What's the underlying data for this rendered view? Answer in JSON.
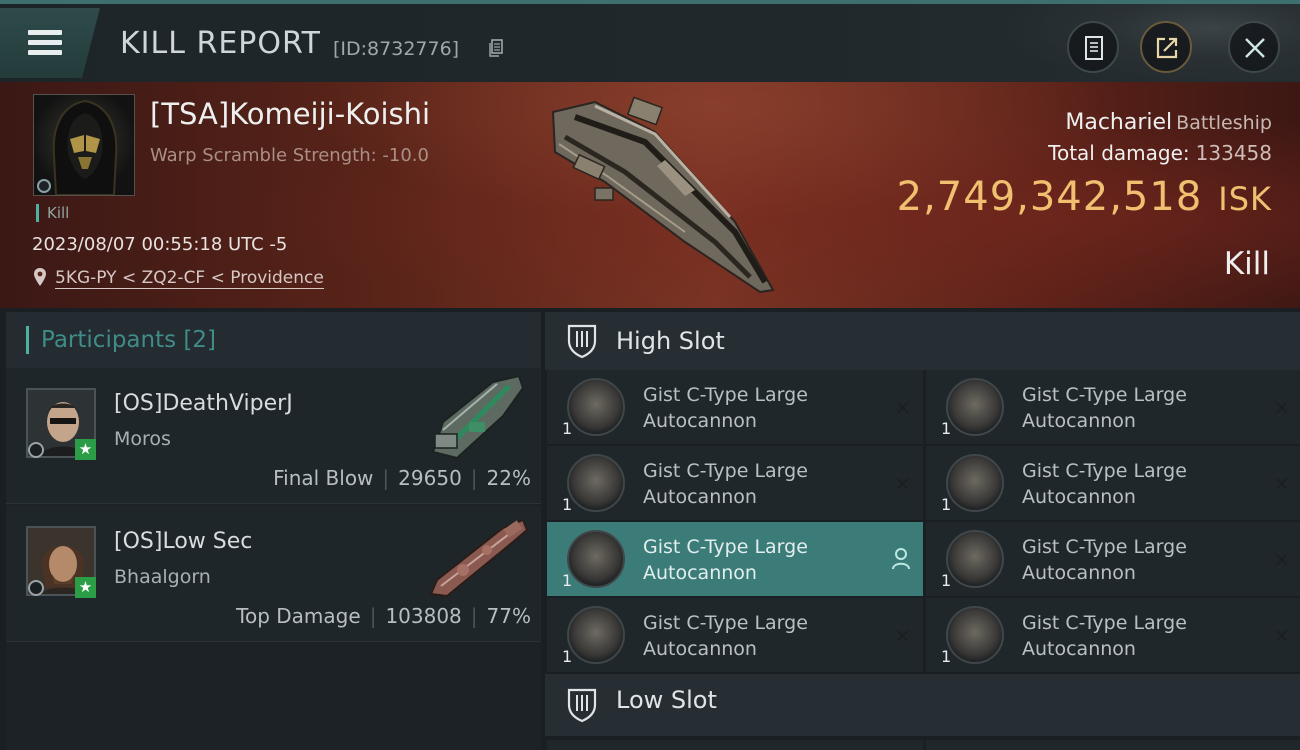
{
  "header": {
    "title": "KILL REPORT",
    "report_id": "[ID:8732776]"
  },
  "victim": {
    "name": "[TSA]Komeiji-Koishi",
    "warp_scramble": "Warp Scramble Strength: -10.0",
    "kill_tag": "Kill",
    "timestamp": "2023/08/07 00:55:18 UTC -5",
    "location": "5KG-PY < ZQ2-CF < Providence",
    "ship_name": "Machariel",
    "ship_class": "Battleship",
    "total_damage_label": "Total damage:",
    "total_damage": "133458",
    "isk_value": "2,749,342,518",
    "isk_unit": "ISK",
    "outcome": "Kill"
  },
  "participants": {
    "title": "Participants [2]",
    "list": [
      {
        "name": "[OS]DeathViperJ",
        "ship": "Moros",
        "role": "Final Blow",
        "damage": "29650",
        "percent": "22%"
      },
      {
        "name": "[OS]Low Sec",
        "ship": "Bhaalgorn",
        "role": "Top Damage",
        "damage": "103808",
        "percent": "77%"
      }
    ]
  },
  "fitting": {
    "high_slot_label": "High Slot",
    "low_slot_label": "Low Slot",
    "modules": [
      {
        "qty": "1",
        "line1": "Gist C-Type Large",
        "line2": "Autocannon",
        "status": "destroyed"
      },
      {
        "qty": "1",
        "line1": "Gist C-Type Large",
        "line2": "Autocannon",
        "status": "destroyed"
      },
      {
        "qty": "1",
        "line1": "Gist C-Type Large",
        "line2": "Autocannon",
        "status": "destroyed"
      },
      {
        "qty": "1",
        "line1": "Gist C-Type Large",
        "line2": "Autocannon",
        "status": "destroyed"
      },
      {
        "qty": "1",
        "line1": "Gist C-Type Large",
        "line2": "Autocannon",
        "status": "dropped"
      },
      {
        "qty": "1",
        "line1": "Gist C-Type Large",
        "line2": "Autocannon",
        "status": "destroyed"
      },
      {
        "qty": "1",
        "line1": "Gist C-Type Large",
        "line2": "Autocannon",
        "status": "destroyed"
      },
      {
        "qty": "1",
        "line1": "Gist C-Type Large",
        "line2": "Autocannon",
        "status": "destroyed"
      }
    ]
  },
  "colors": {
    "accent": "#4fb0a0",
    "isk": "#f0c070",
    "active_row": "#3b7c79",
    "victim_bg": "#5a2419"
  },
  "icons": {
    "menu": "menu-icon",
    "clipboard": "clipboard-icon",
    "share": "share-icon",
    "close": "close-icon",
    "location": "location-pin-icon",
    "slot": "shield-slot-icon",
    "destroyed": "x-icon",
    "dropped": "person-icon"
  }
}
